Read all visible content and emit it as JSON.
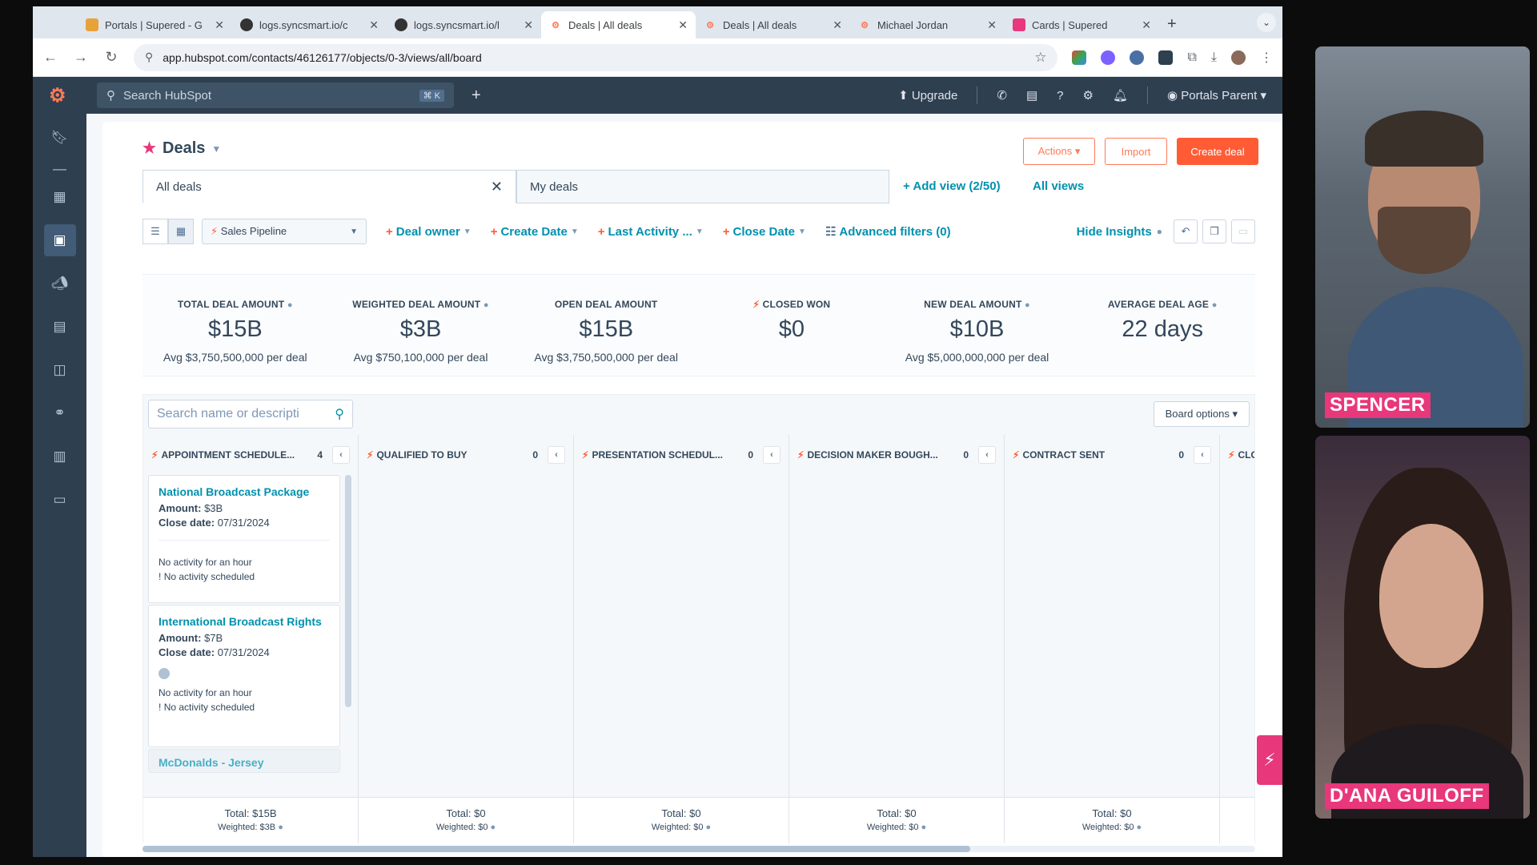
{
  "browser": {
    "tabs": [
      {
        "title": "Portals | Supered - G",
        "fav_color": "#e8a23a",
        "active": false
      },
      {
        "title": "logs.syncsmart.io/c",
        "fav_color": "#333333",
        "active": false
      },
      {
        "title": "logs.syncsmart.io/l",
        "fav_color": "#333333",
        "active": false
      },
      {
        "title": "Deals | All deals",
        "fav_color": "#ff7a59",
        "active": true
      },
      {
        "title": "Deals | All deals",
        "fav_color": "#ff7a59",
        "active": false
      },
      {
        "title": "Michael Jordan",
        "fav_color": "#ff7a59",
        "active": false
      },
      {
        "title": "Cards | Supered",
        "fav_color": "#e8377a",
        "active": false
      }
    ],
    "url": "app.hubspot.com/contacts/46126177/objects/0-3/views/all/board"
  },
  "hubspot": {
    "search_placeholder": "Search HubSpot",
    "search_shortcut": "⌘ K",
    "upgrade": "Upgrade",
    "account": "Portals Parent"
  },
  "page": {
    "title": "Deals",
    "actions": "Actions ▾",
    "import": "Import",
    "create": "Create deal",
    "views": [
      "All deals",
      "My deals"
    ],
    "add_view": "+ Add view (2/50)",
    "all_views": "All views"
  },
  "filters": {
    "pipeline": "Sales Pipeline",
    "items": [
      "Deal owner",
      "Create Date",
      "Last Activity ...",
      "Close Date"
    ],
    "advanced": "Advanced filters (0)",
    "hide_insights": "Hide Insights"
  },
  "insights": [
    {
      "label": "TOTAL DEAL AMOUNT",
      "value": "$15B",
      "avg": "Avg $3,750,500,000 per deal"
    },
    {
      "label": "WEIGHTED DEAL AMOUNT",
      "value": "$3B",
      "avg": "Avg $750,100,000 per deal"
    },
    {
      "label": "OPEN DEAL AMOUNT",
      "value": "$15B",
      "avg": "Avg $3,750,500,000 per deal"
    },
    {
      "label": "CLOSED WON",
      "value": "$0",
      "avg": ""
    },
    {
      "label": "NEW DEAL AMOUNT",
      "value": "$10B",
      "avg": "Avg $5,000,000,000 per deal"
    },
    {
      "label": "AVERAGE DEAL AGE",
      "value": "22 days",
      "avg": ""
    }
  ],
  "board": {
    "search_placeholder": "Search name or descripti",
    "options": "Board options ▾",
    "columns": [
      {
        "name": "APPOINTMENT SCHEDULE...",
        "count": "4",
        "total": "Total: $15B",
        "weighted": "Weighted: $3B"
      },
      {
        "name": "QUALIFIED TO BUY",
        "count": "0",
        "total": "Total: $0",
        "weighted": "Weighted: $0"
      },
      {
        "name": "PRESENTATION SCHEDUL...",
        "count": "0",
        "total": "Total: $0",
        "weighted": "Weighted: $0"
      },
      {
        "name": "DECISION MAKER BOUGH...",
        "count": "0",
        "total": "Total: $0",
        "weighted": "Weighted: $0"
      },
      {
        "name": "CONTRACT SENT",
        "count": "0",
        "total": "Total: $0",
        "weighted": "Weighted: $0"
      },
      {
        "name": "CLO",
        "count": "",
        "total": "",
        "weighted": ""
      }
    ],
    "cards": [
      {
        "name": "National Broadcast Package",
        "amount_label": "Amount:",
        "amount": "$3B",
        "close_label": "Close date:",
        "close": "07/31/2024",
        "activity": "No activity for an hour",
        "scheduled": "No activity scheduled"
      },
      {
        "name": "International Broadcast Rights",
        "amount_label": "Amount:",
        "amount": "$7B",
        "close_label": "Close date:",
        "close": "07/31/2024",
        "activity": "No activity for an hour",
        "scheduled": "No activity scheduled"
      },
      {
        "name": "McDonalds - Jersey"
      }
    ]
  },
  "participants": [
    {
      "name": "SPENCER"
    },
    {
      "name": "D'ANA GUILOFF"
    }
  ]
}
